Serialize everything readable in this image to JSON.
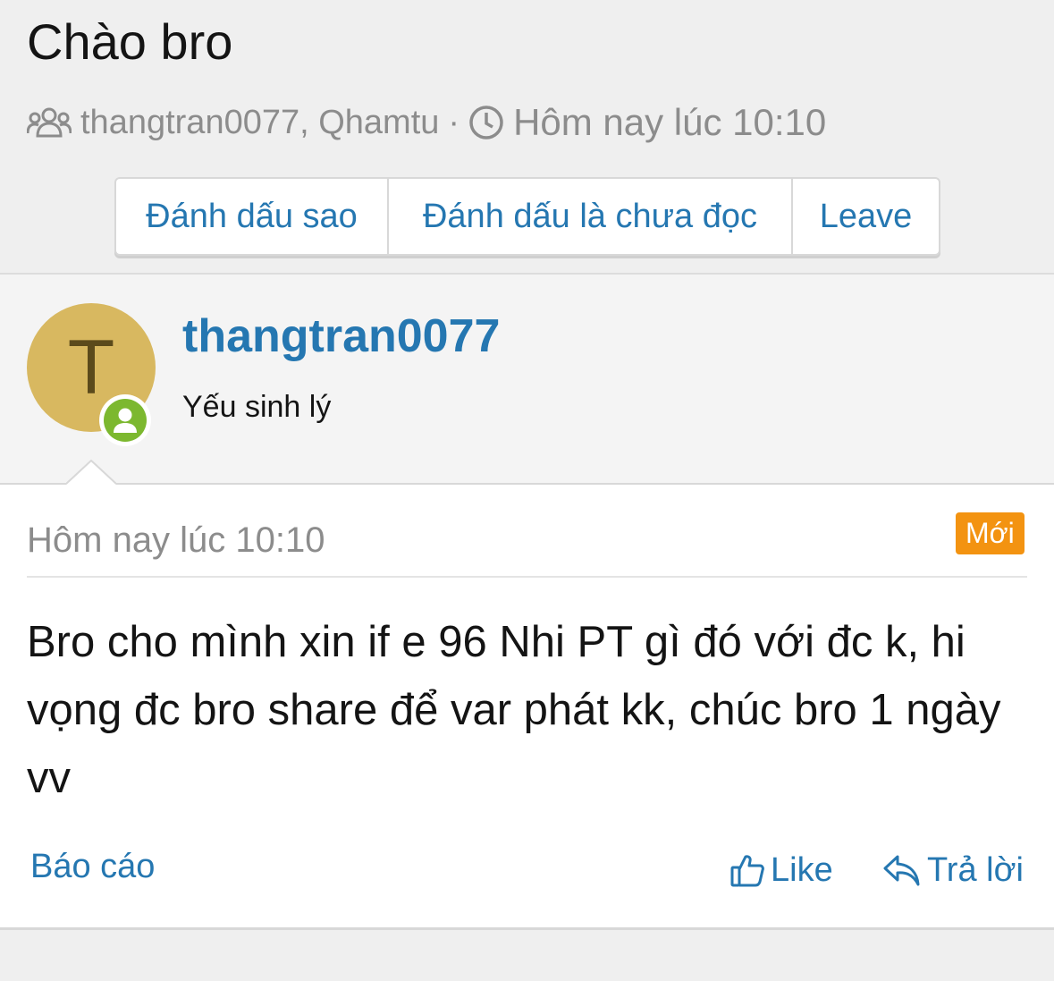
{
  "thread": {
    "title": "Chào bro",
    "participants": "thangtran0077, Qhamtu",
    "separator": "·",
    "time": "Hôm nay lúc 10:10"
  },
  "actions": {
    "star": "Đánh dấu sao",
    "mark_unread": "Đánh dấu là chưa đọc",
    "leave": "Leave"
  },
  "user": {
    "avatar_letter": "T",
    "name": "thangtran0077",
    "title": "Yếu sinh lý",
    "avatar_color": "#d8b860",
    "online_color": "#7cb82f"
  },
  "message": {
    "date": "Hôm nay lúc 10:10",
    "badge": "Mới",
    "body": "Bro cho mình xin if e 96 Nhi PT gì đó với đc k, hi vọng đc bro share để var phát kk, chúc bro 1 ngày vv",
    "report": "Báo cáo",
    "like": "Like",
    "reply": "Trả lời"
  },
  "colors": {
    "link": "#2577b1",
    "badge": "#f39311",
    "muted": "#8c8c8c"
  },
  "icons": {
    "participants": "users-icon",
    "time": "clock-icon",
    "like": "thumbs-up-icon",
    "reply": "reply-icon",
    "status": "user-online-icon"
  }
}
